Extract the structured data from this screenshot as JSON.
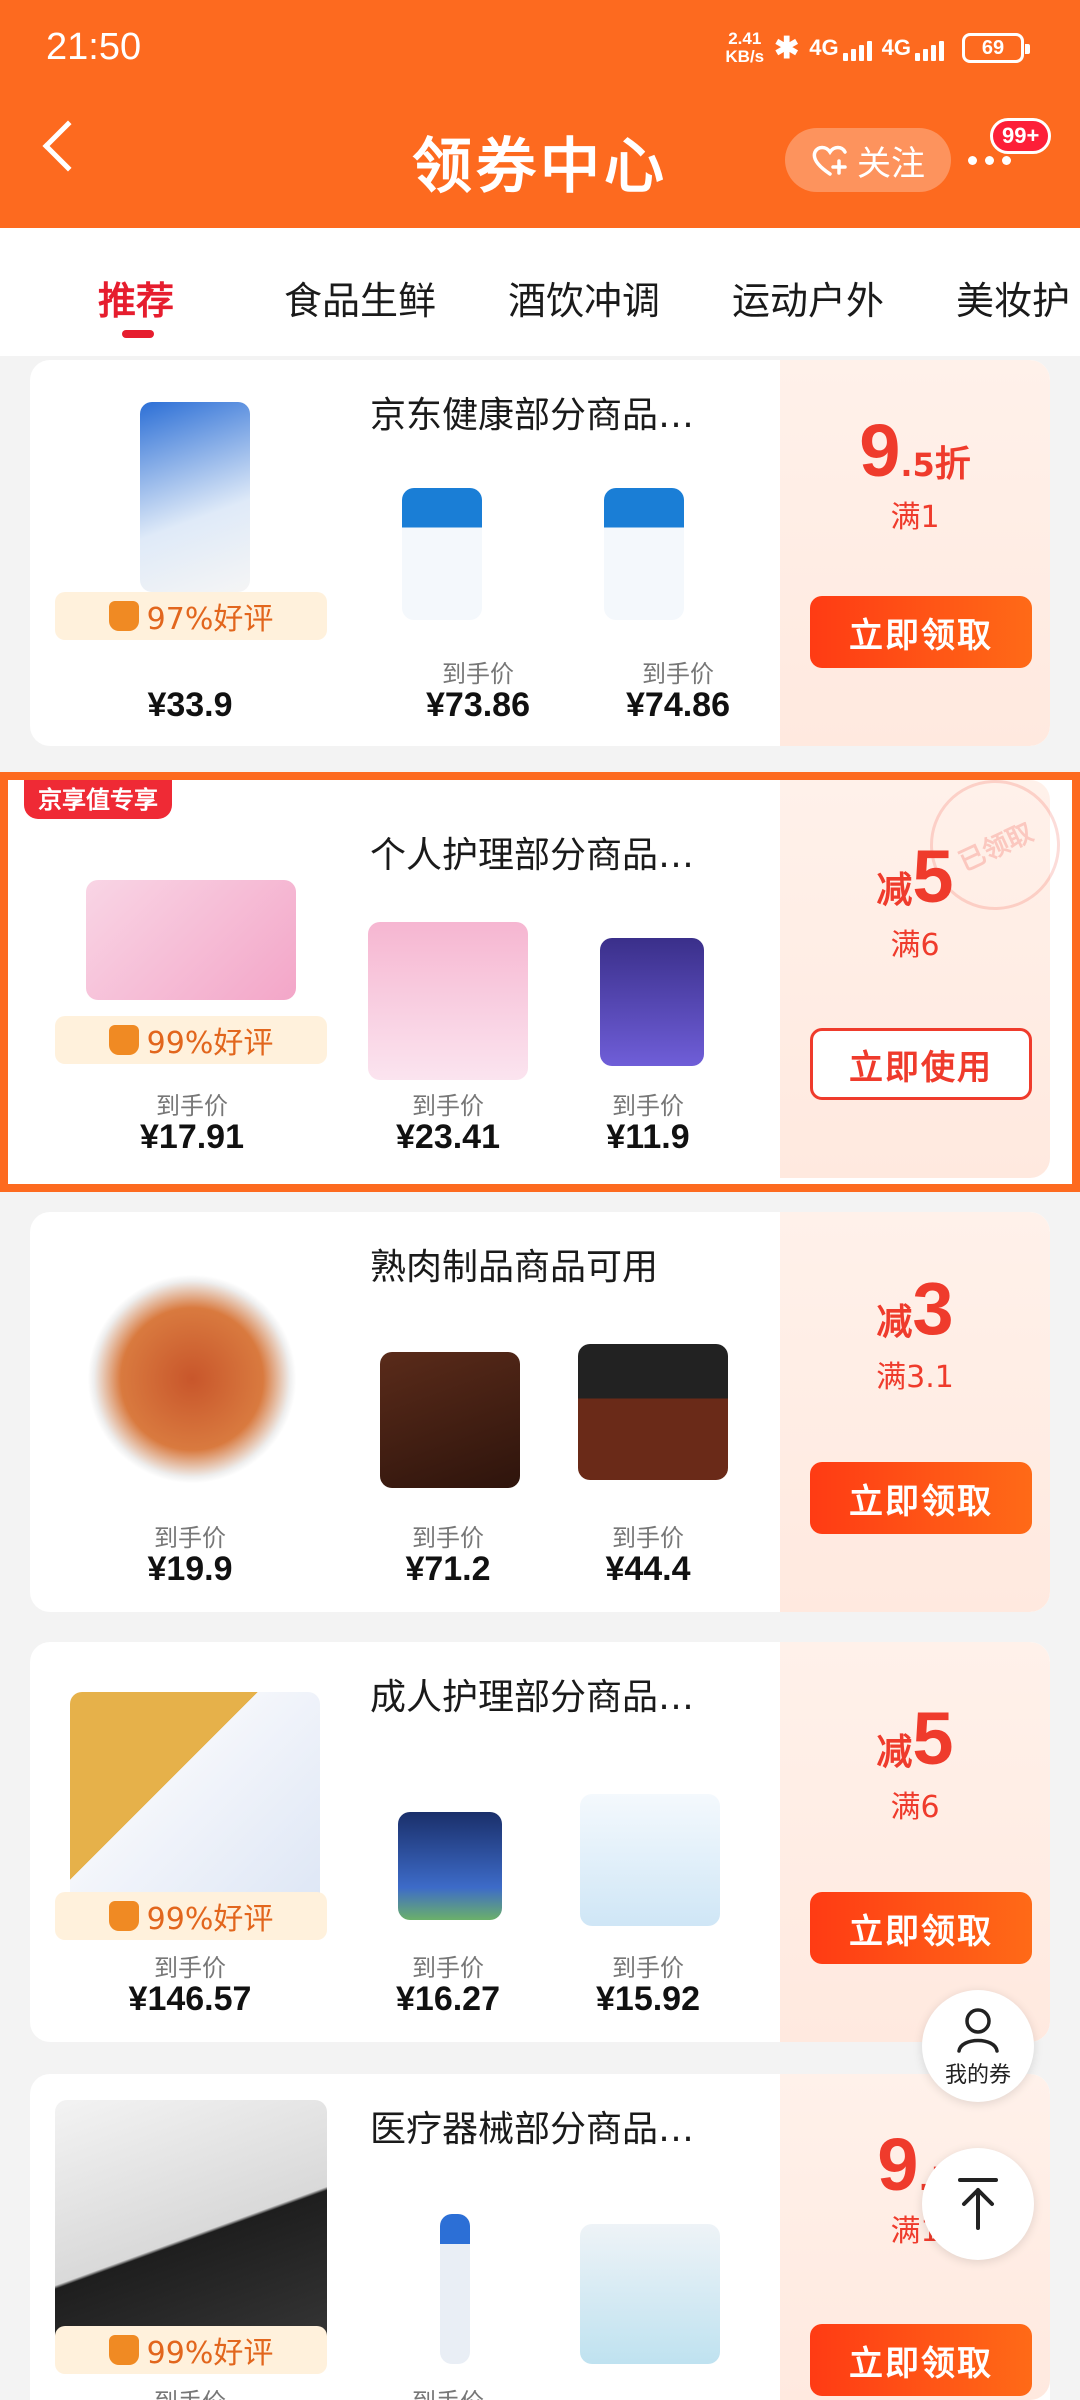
{
  "status_bar": {
    "time": "21:50",
    "net_speed_value": "2.41",
    "net_speed_unit": "KB/s",
    "sig1": "4G",
    "sig2": "4G",
    "battery": "69"
  },
  "header": {
    "title": "领券中心",
    "follow_label": "关注",
    "badge": "99+"
  },
  "tabs": [
    {
      "label": "推荐",
      "active": true
    },
    {
      "label": "食品生鲜"
    },
    {
      "label": "酒饮冲调"
    },
    {
      "label": "运动户外"
    },
    {
      "label": "美妆护"
    }
  ],
  "coupons": [
    {
      "title": "京东健康部分商品…",
      "rating": "97%好评",
      "products": [
        {
          "price_label": "",
          "price": "¥33.9"
        },
        {
          "price_label": "到手价",
          "price": "¥73.86"
        },
        {
          "price_label": "到手价",
          "price": "¥74.86"
        }
      ],
      "discount_number": "9",
      "discount_decimal": ".5",
      "discount_unit": "折",
      "condition": "满1",
      "button": "立即领取"
    },
    {
      "tag": "京享值专享",
      "title": "个人护理部分商品…",
      "rating": "99%好评",
      "products": [
        {
          "price_label": "到手价",
          "price": "¥17.91"
        },
        {
          "price_label": "到手价",
          "price": "¥23.41"
        },
        {
          "price_label": "到手价",
          "price": "¥11.9"
        }
      ],
      "discount_prefix": "减",
      "discount_number": "5",
      "condition": "满6",
      "button": "立即使用",
      "stamp": "已领取"
    },
    {
      "title": "熟肉制品商品可用",
      "products": [
        {
          "price_label": "到手价",
          "price": "¥19.9"
        },
        {
          "price_label": "到手价",
          "price": "¥71.2"
        },
        {
          "price_label": "到手价",
          "price": "¥44.4"
        }
      ],
      "discount_prefix": "减",
      "discount_number": "3",
      "condition": "满3.1",
      "button": "立即领取"
    },
    {
      "title": "成人护理部分商品…",
      "rating": "99%好评",
      "products": [
        {
          "price_label": "到手价",
          "price": "¥146.57"
        },
        {
          "price_label": "到手价",
          "price": "¥16.27"
        },
        {
          "price_label": "到手价",
          "price": "¥15.92"
        }
      ],
      "discount_prefix": "减",
      "discount_number": "5",
      "condition": "满6",
      "button": "立即领取"
    },
    {
      "title": "医疗器械部分商品…",
      "rating": "99%好评",
      "products": [
        {
          "price_label": "到手价",
          "price": ""
        },
        {
          "price_label": "到手价",
          "price": ""
        },
        {
          "price_label": "",
          "price": ""
        }
      ],
      "discount_number": "9",
      "discount_decimal": ".5",
      "condition": "满1",
      "button": "立即领取"
    }
  ],
  "float": {
    "my_coupons": "我的券"
  },
  "colors": {
    "brand": "#fd6a1f",
    "accent_red": "#ef3b2c",
    "button_grad_start": "#ff3b14",
    "button_grad_end": "#ff6a17"
  }
}
